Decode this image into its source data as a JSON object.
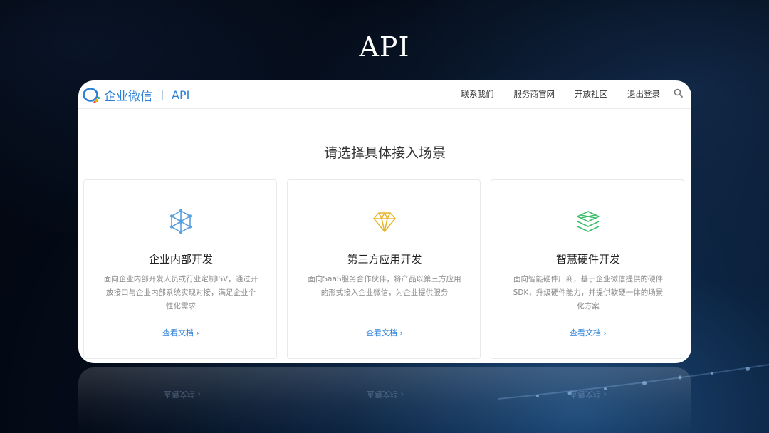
{
  "slide": {
    "title": "API"
  },
  "app": {
    "logo_text": "企业微信",
    "logo_suffix": "API",
    "nav": [
      "联系我们",
      "服务商官网",
      "开放社区",
      "退出登录"
    ]
  },
  "main": {
    "heading": "请选择具体接入场景",
    "cards": [
      {
        "title": "企业内部开发",
        "description": "面向企业内部开发人员或行业定制ISV，通过开放接口与企业内部系统实现对接，满足企业个性化需求",
        "link": "查看文档 ›",
        "icon": "network-icon",
        "icon_color": "#5a9fe0"
      },
      {
        "title": "第三方应用开发",
        "description": "面向SaaS服务合作伙伴，将产品以第三方应用的形式接入企业微信，为企业提供服务",
        "link": "查看文档 ›",
        "icon": "diamond-icon",
        "icon_color": "#e8b62a"
      },
      {
        "title": "智慧硬件开发",
        "description": "面向智能硬件厂商，基于企业微信提供的硬件SDK，升级硬件能力，并提供软硬一体的场景化方案",
        "link": "查看文档 ›",
        "icon": "layers-icon",
        "icon_color": "#3cbf6a"
      }
    ]
  },
  "colors": {
    "brand_blue": "#2b80d6",
    "background_dark": "#040b18"
  }
}
